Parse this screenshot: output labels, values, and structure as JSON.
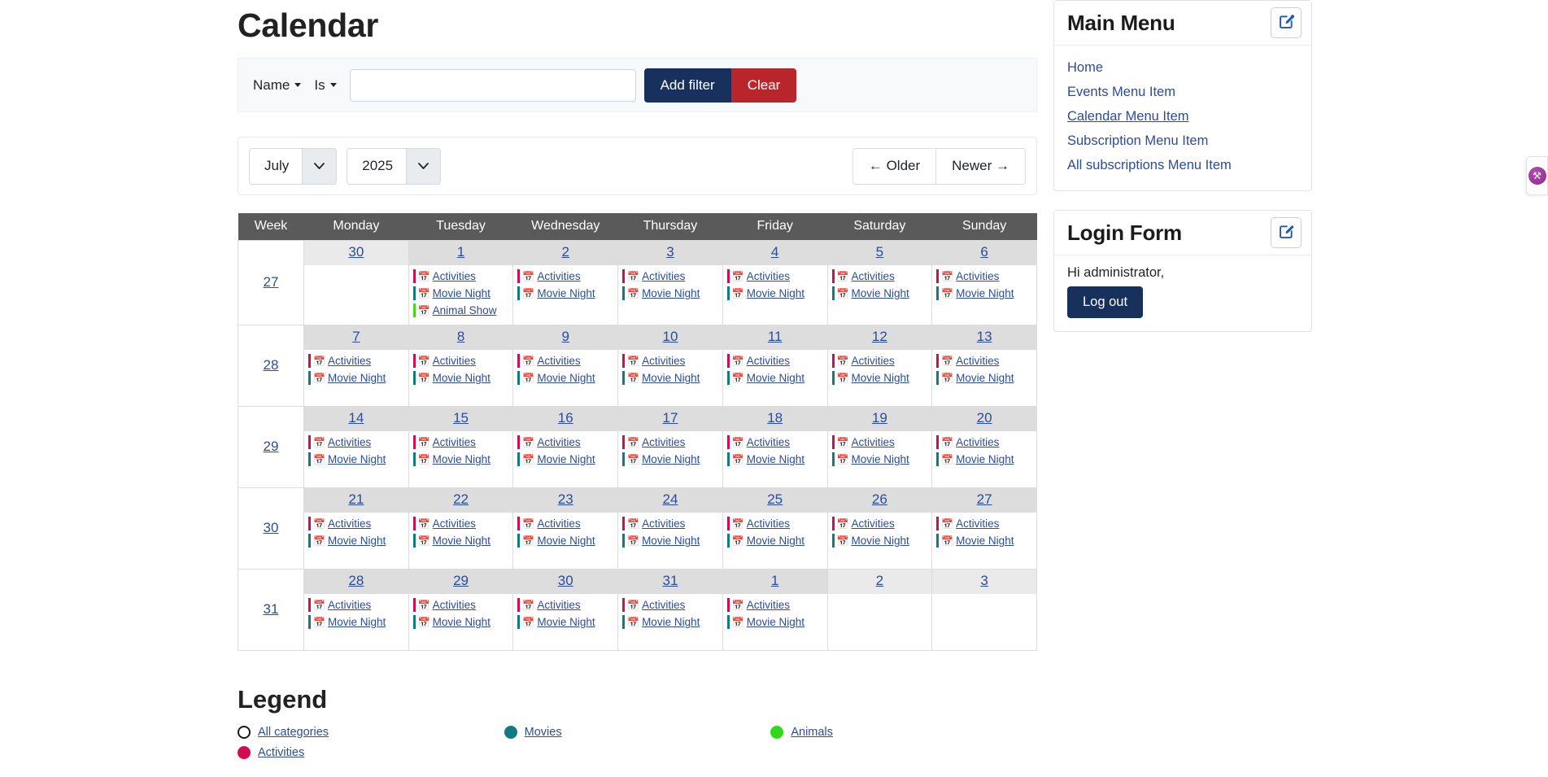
{
  "page": {
    "title": "Calendar"
  },
  "filter": {
    "field_label": "Name",
    "operator_label": "Is",
    "value": "",
    "placeholder": "",
    "add_filter_label": "Add filter",
    "clear_label": "Clear"
  },
  "nav": {
    "month": "July",
    "year": "2025",
    "older_label": "← Older",
    "newer_label": "Newer →"
  },
  "calendar": {
    "columns": [
      "Week",
      "Monday",
      "Tuesday",
      "Wednesday",
      "Thursday",
      "Friday",
      "Saturday",
      "Sunday"
    ],
    "event_colors": {
      "Activities": "#d40b51",
      "Movie Night": "#0f7b84",
      "Animal Show": "#49d71a"
    },
    "weeks": [
      {
        "week": "27",
        "days": [
          {
            "num": "30",
            "other_month": true,
            "events": []
          },
          {
            "num": "1",
            "other_month": false,
            "events": [
              "Activities",
              "Movie Night",
              "Animal Show"
            ]
          },
          {
            "num": "2",
            "other_month": false,
            "events": [
              "Activities",
              "Movie Night"
            ]
          },
          {
            "num": "3",
            "other_month": false,
            "events": [
              "Activities",
              "Movie Night"
            ]
          },
          {
            "num": "4",
            "other_month": false,
            "events": [
              "Activities",
              "Movie Night"
            ]
          },
          {
            "num": "5",
            "other_month": false,
            "events": [
              "Activities",
              "Movie Night"
            ]
          },
          {
            "num": "6",
            "other_month": false,
            "events": [
              "Activities",
              "Movie Night"
            ]
          }
        ]
      },
      {
        "week": "28",
        "days": [
          {
            "num": "7",
            "other_month": false,
            "events": [
              "Activities",
              "Movie Night"
            ]
          },
          {
            "num": "8",
            "other_month": false,
            "events": [
              "Activities",
              "Movie Night"
            ]
          },
          {
            "num": "9",
            "other_month": false,
            "events": [
              "Activities",
              "Movie Night"
            ]
          },
          {
            "num": "10",
            "other_month": false,
            "events": [
              "Activities",
              "Movie Night"
            ]
          },
          {
            "num": "11",
            "other_month": false,
            "events": [
              "Activities",
              "Movie Night"
            ]
          },
          {
            "num": "12",
            "other_month": false,
            "events": [
              "Activities",
              "Movie Night"
            ]
          },
          {
            "num": "13",
            "other_month": false,
            "events": [
              "Activities",
              "Movie Night"
            ]
          }
        ]
      },
      {
        "week": "29",
        "days": [
          {
            "num": "14",
            "other_month": false,
            "events": [
              "Activities",
              "Movie Night"
            ]
          },
          {
            "num": "15",
            "other_month": false,
            "events": [
              "Activities",
              "Movie Night"
            ]
          },
          {
            "num": "16",
            "other_month": false,
            "events": [
              "Activities",
              "Movie Night"
            ]
          },
          {
            "num": "17",
            "other_month": false,
            "events": [
              "Activities",
              "Movie Night"
            ]
          },
          {
            "num": "18",
            "other_month": false,
            "events": [
              "Activities",
              "Movie Night"
            ]
          },
          {
            "num": "19",
            "other_month": false,
            "events": [
              "Activities",
              "Movie Night"
            ]
          },
          {
            "num": "20",
            "other_month": false,
            "events": [
              "Activities",
              "Movie Night"
            ]
          }
        ]
      },
      {
        "week": "30",
        "days": [
          {
            "num": "21",
            "other_month": false,
            "events": [
              "Activities",
              "Movie Night"
            ]
          },
          {
            "num": "22",
            "other_month": false,
            "events": [
              "Activities",
              "Movie Night"
            ]
          },
          {
            "num": "23",
            "other_month": false,
            "events": [
              "Activities",
              "Movie Night"
            ]
          },
          {
            "num": "24",
            "other_month": false,
            "events": [
              "Activities",
              "Movie Night"
            ]
          },
          {
            "num": "25",
            "other_month": false,
            "events": [
              "Activities",
              "Movie Night"
            ]
          },
          {
            "num": "26",
            "other_month": false,
            "events": [
              "Activities",
              "Movie Night"
            ]
          },
          {
            "num": "27",
            "other_month": false,
            "events": [
              "Activities",
              "Movie Night"
            ]
          }
        ]
      },
      {
        "week": "31",
        "days": [
          {
            "num": "28",
            "other_month": false,
            "events": [
              "Activities",
              "Movie Night"
            ]
          },
          {
            "num": "29",
            "other_month": false,
            "events": [
              "Activities",
              "Movie Night"
            ]
          },
          {
            "num": "30",
            "other_month": false,
            "events": [
              "Activities",
              "Movie Night"
            ]
          },
          {
            "num": "31",
            "other_month": false,
            "events": [
              "Activities",
              "Movie Night"
            ]
          },
          {
            "num": "1",
            "other_month": false,
            "events": [
              "Activities",
              "Movie Night"
            ]
          },
          {
            "num": "2",
            "other_month": true,
            "events": []
          },
          {
            "num": "3",
            "other_month": true,
            "events": []
          }
        ]
      }
    ]
  },
  "legend": {
    "title": "Legend",
    "items": [
      {
        "label": "All categories",
        "color": "#ffffff",
        "hollow": true
      },
      {
        "label": "Movies",
        "color": "#0f7b84",
        "hollow": false
      },
      {
        "label": "Animals",
        "color": "#2fdb16",
        "hollow": false
      },
      {
        "label": "Activities",
        "color": "#d40b51",
        "hollow": false
      }
    ]
  },
  "sidebar": {
    "main_menu": {
      "title": "Main Menu",
      "items": [
        {
          "label": "Home",
          "active": false
        },
        {
          "label": "Events Menu Item",
          "active": false
        },
        {
          "label": "Calendar Menu Item",
          "active": true
        },
        {
          "label": "Subscription Menu Item",
          "active": false
        },
        {
          "label": "All subscriptions Menu Item",
          "active": false
        }
      ]
    },
    "login_form": {
      "title": "Login Form",
      "greeting": "Hi administrator,",
      "logout_label": "Log out"
    }
  },
  "accent": {
    "primary": "#17305c",
    "danger": "#b8252a",
    "link": "#2b4c9b",
    "header_gray": "#5a5a5a"
  }
}
